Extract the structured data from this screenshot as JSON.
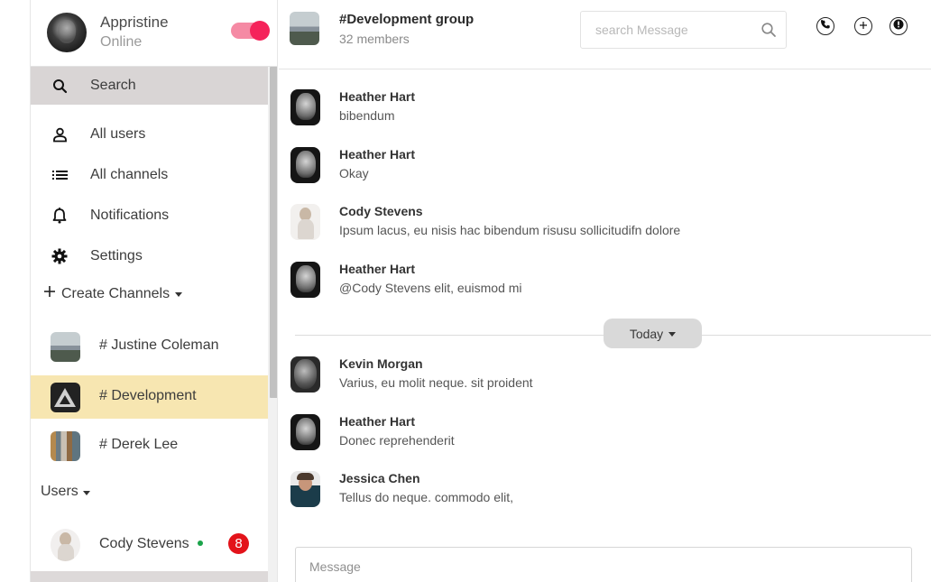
{
  "me": {
    "name": "Appristine",
    "status": "Online"
  },
  "nav": [
    {
      "key": "search",
      "label": "Search"
    },
    {
      "key": "users",
      "label": "All users"
    },
    {
      "key": "channels",
      "label": "All channels"
    },
    {
      "key": "notifications",
      "label": "Notifications"
    },
    {
      "key": "settings",
      "label": "Settings"
    }
  ],
  "create_channels_label": "Create Channels",
  "channels": [
    {
      "label": "# Justine Coleman"
    },
    {
      "label": "# Development"
    },
    {
      "label": "# Derek Lee"
    }
  ],
  "users_label": "Users",
  "users": [
    {
      "name": "Cody Stevens",
      "unread": "8"
    }
  ],
  "group": {
    "title": "#Development group",
    "members": "32 members"
  },
  "search": {
    "placeholder": "search Message"
  },
  "messages": [
    {
      "author": "Heather Hart",
      "text": "bibendum"
    },
    {
      "author": "Heather Hart",
      "text": "Okay"
    },
    {
      "author": "Cody Stevens",
      "text": "Ipsum lacus, eu nisis hac bibendum risusu sollicitudifn dolore"
    },
    {
      "author": "Heather Hart",
      "text": "@Cody Stevens elit, euismod mi"
    },
    {
      "author": "Kevin Morgan",
      "text": "Varius, eu molit neque. sit proident"
    },
    {
      "author": "Heather Hart",
      "text": "Donec reprehenderit"
    },
    {
      "author": "Jessica Chen",
      "text": "Tellus do neque. commodo elit,"
    }
  ],
  "divider_label": "Today",
  "composer": {
    "placeholder": "Message"
  },
  "colors": {
    "toggle_on": "#f5235a",
    "active_channel": "#f7e6b1",
    "badge": "#e3131a",
    "online": "#1aa34a"
  }
}
